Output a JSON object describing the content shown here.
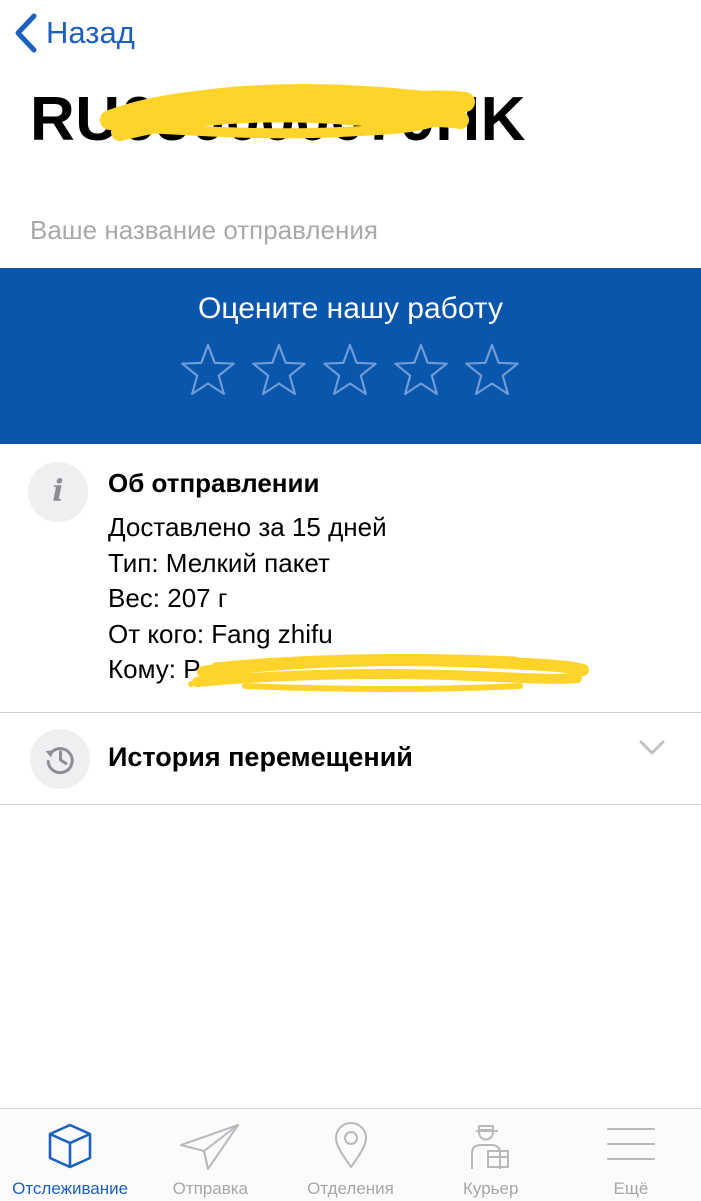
{
  "nav": {
    "back_label": "Назад"
  },
  "shipment": {
    "tracking_number": "RU650000079HK",
    "name_placeholder": "Ваше название отправления"
  },
  "rating": {
    "title": "Оцените нашу работу",
    "stars_total": 5,
    "stars_selected": 0
  },
  "info": {
    "title": "Об отправлении",
    "lines": [
      "Доставлено за 15 дней",
      "Тип: Мелкий пакет",
      "Вес: 207 г",
      "От кого: Fang zhifu",
      "Кому: Р"
    ]
  },
  "history": {
    "title": "История перемещений"
  },
  "tabbar": {
    "active": 0,
    "tabs": [
      {
        "label": "Отслеживание",
        "icon": "box-icon"
      },
      {
        "label": "Отправка",
        "icon": "paper-plane-icon"
      },
      {
        "label": "Отделения",
        "icon": "location-pin-icon"
      },
      {
        "label": "Курьер",
        "icon": "courier-icon"
      },
      {
        "label": "Ещё",
        "icon": "menu-icon"
      }
    ]
  },
  "colors": {
    "accent": "#1b5fbf",
    "banner": "#0a56ad",
    "redaction": "#ffd42a",
    "inactive": "#a7a7ab"
  }
}
